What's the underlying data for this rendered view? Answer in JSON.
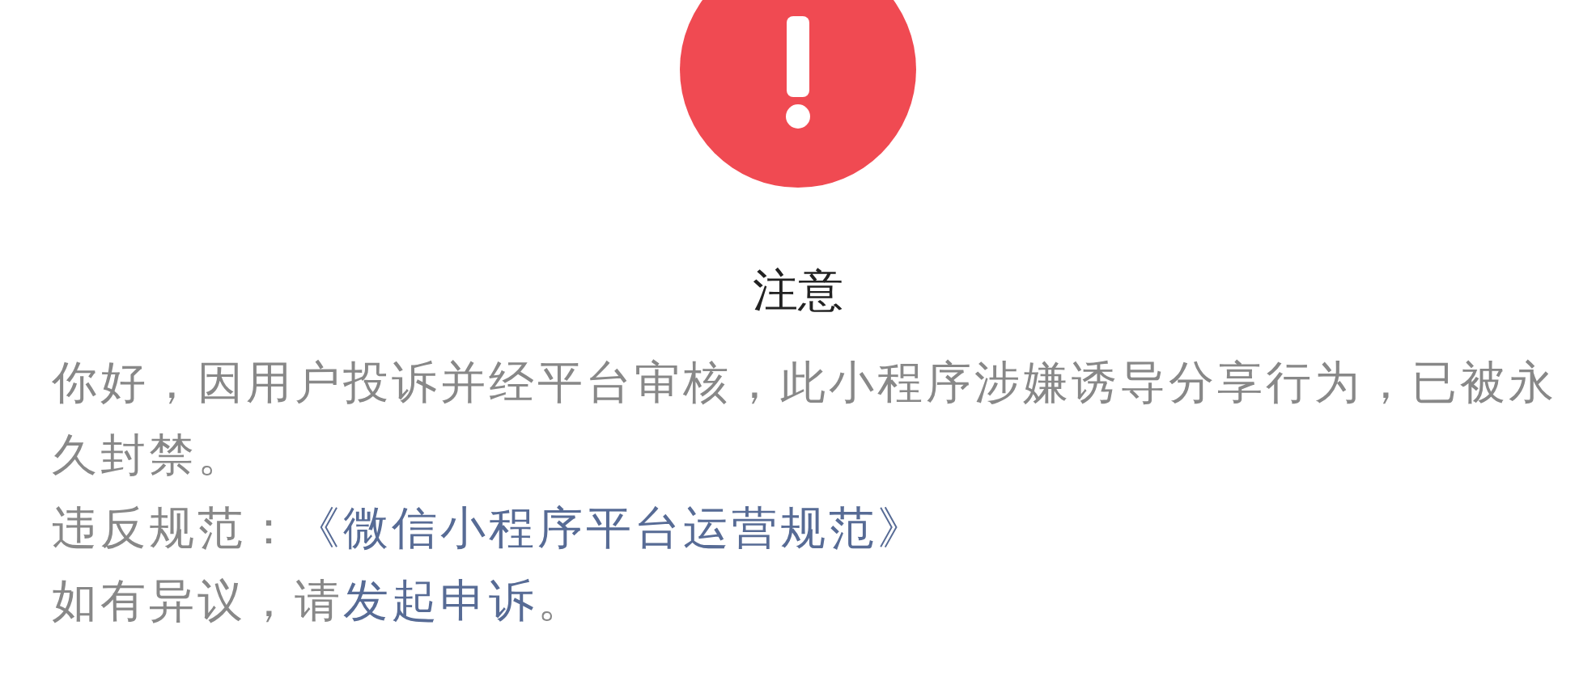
{
  "alert": {
    "title": "注意",
    "message": "你好，因用户投诉并经平台审核，此小程序涉嫌诱导分享行为，已被永久封禁。",
    "violation": {
      "label": "违反规范：",
      "link": "《微信小程序平台运营规范》"
    },
    "appeal": {
      "before": "如有异议，请",
      "link": "发起申诉",
      "after": "。"
    }
  }
}
